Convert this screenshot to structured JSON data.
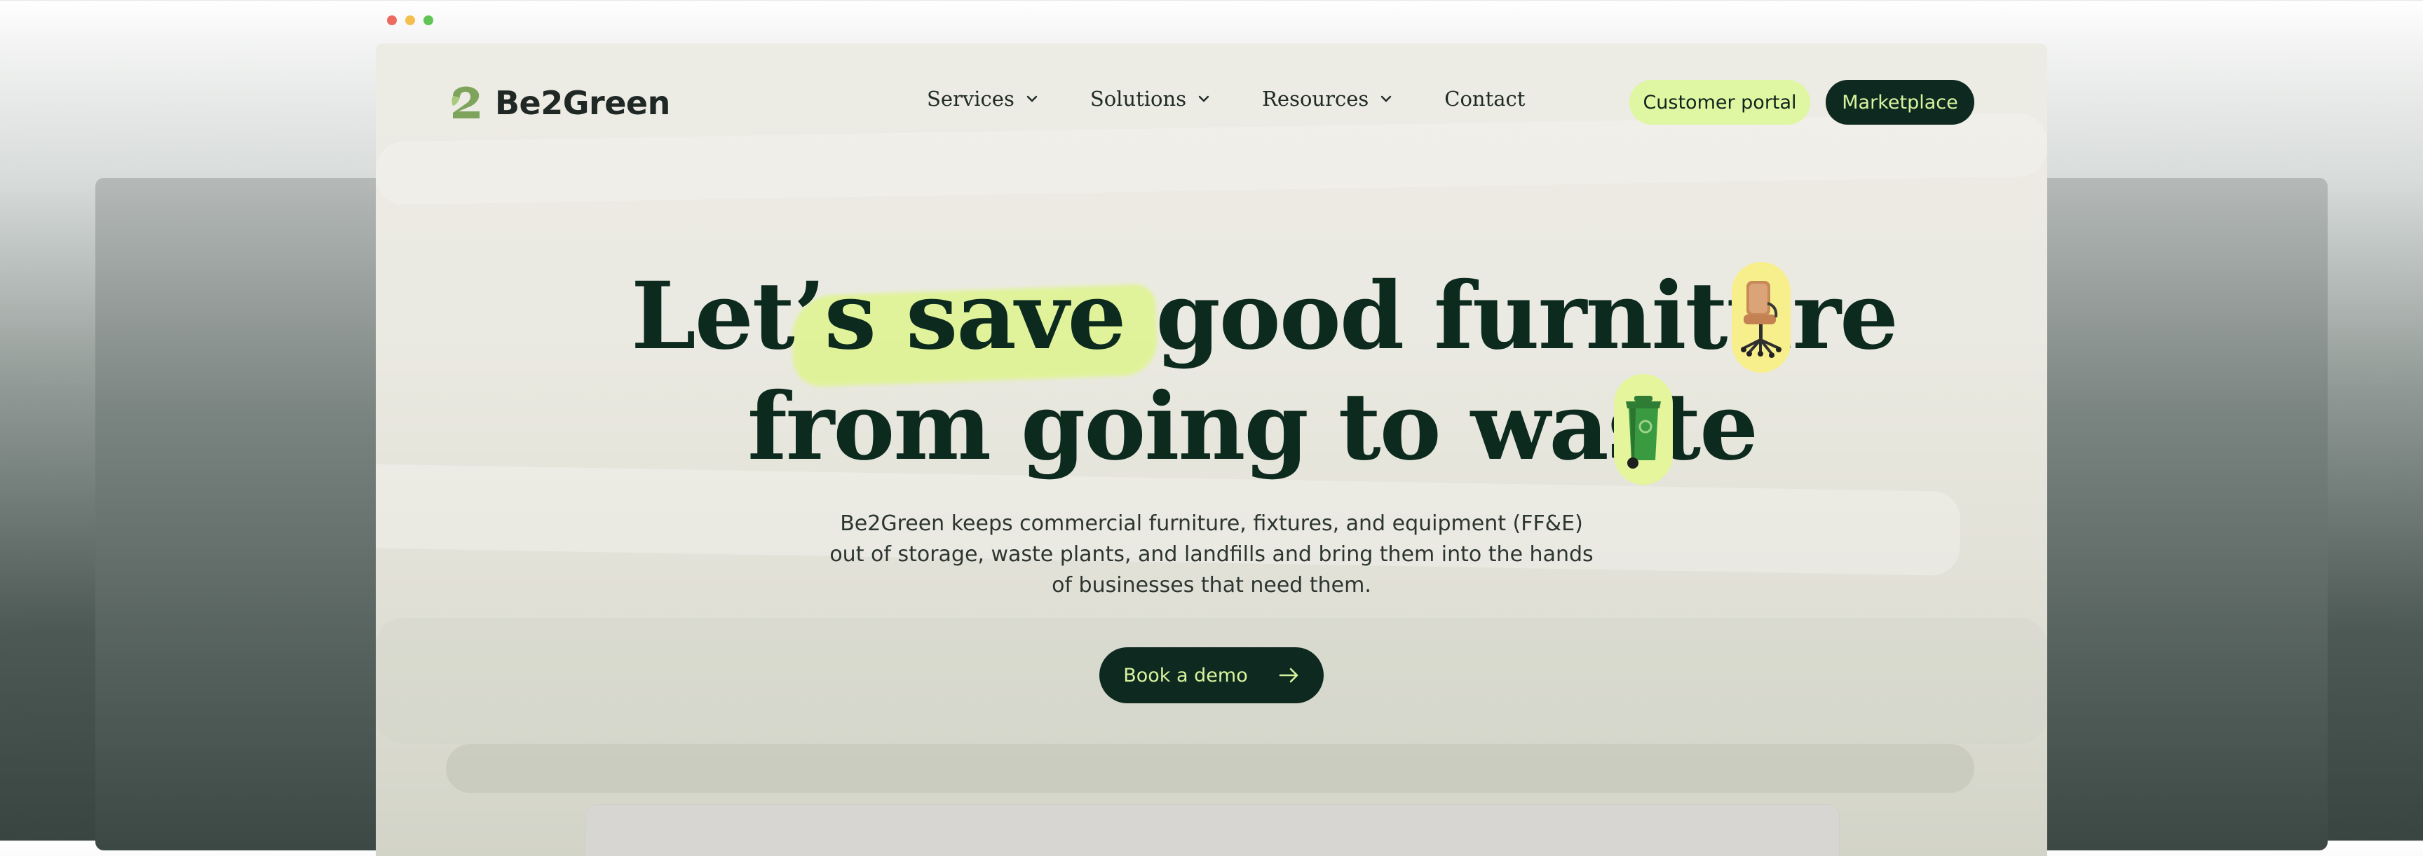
{
  "brand": {
    "name": "Be2Green"
  },
  "nav": {
    "items": [
      {
        "label": "Services"
      },
      {
        "label": "Solutions"
      },
      {
        "label": "Resources"
      },
      {
        "label": "Contact"
      }
    ],
    "portal_label": "Customer portal",
    "marketplace_label": "Marketplace"
  },
  "hero": {
    "line1": "Let’s save good  furniture",
    "line2": "from going to waste",
    "subtitle": "Be2Green keeps commercial furniture, fixtures, and equipment (FF&E) out of storage, waste plants, and landfills and bring them into the hands of businesses that need them.",
    "cta_label": "Book a demo"
  },
  "icons": {
    "logo": "leaf-logo-icon",
    "chevron": "chevron-down-icon",
    "chair": "office-chair-icon",
    "bin": "recycle-bin-icon",
    "arrow": "arrow-right-icon"
  },
  "colors": {
    "dark_green": "#0e2a20",
    "lime": "#dff6a3",
    "highlight": "#dcf682",
    "chair_pill": "#f7ef8c",
    "bin_pill": "#e4f59c"
  }
}
